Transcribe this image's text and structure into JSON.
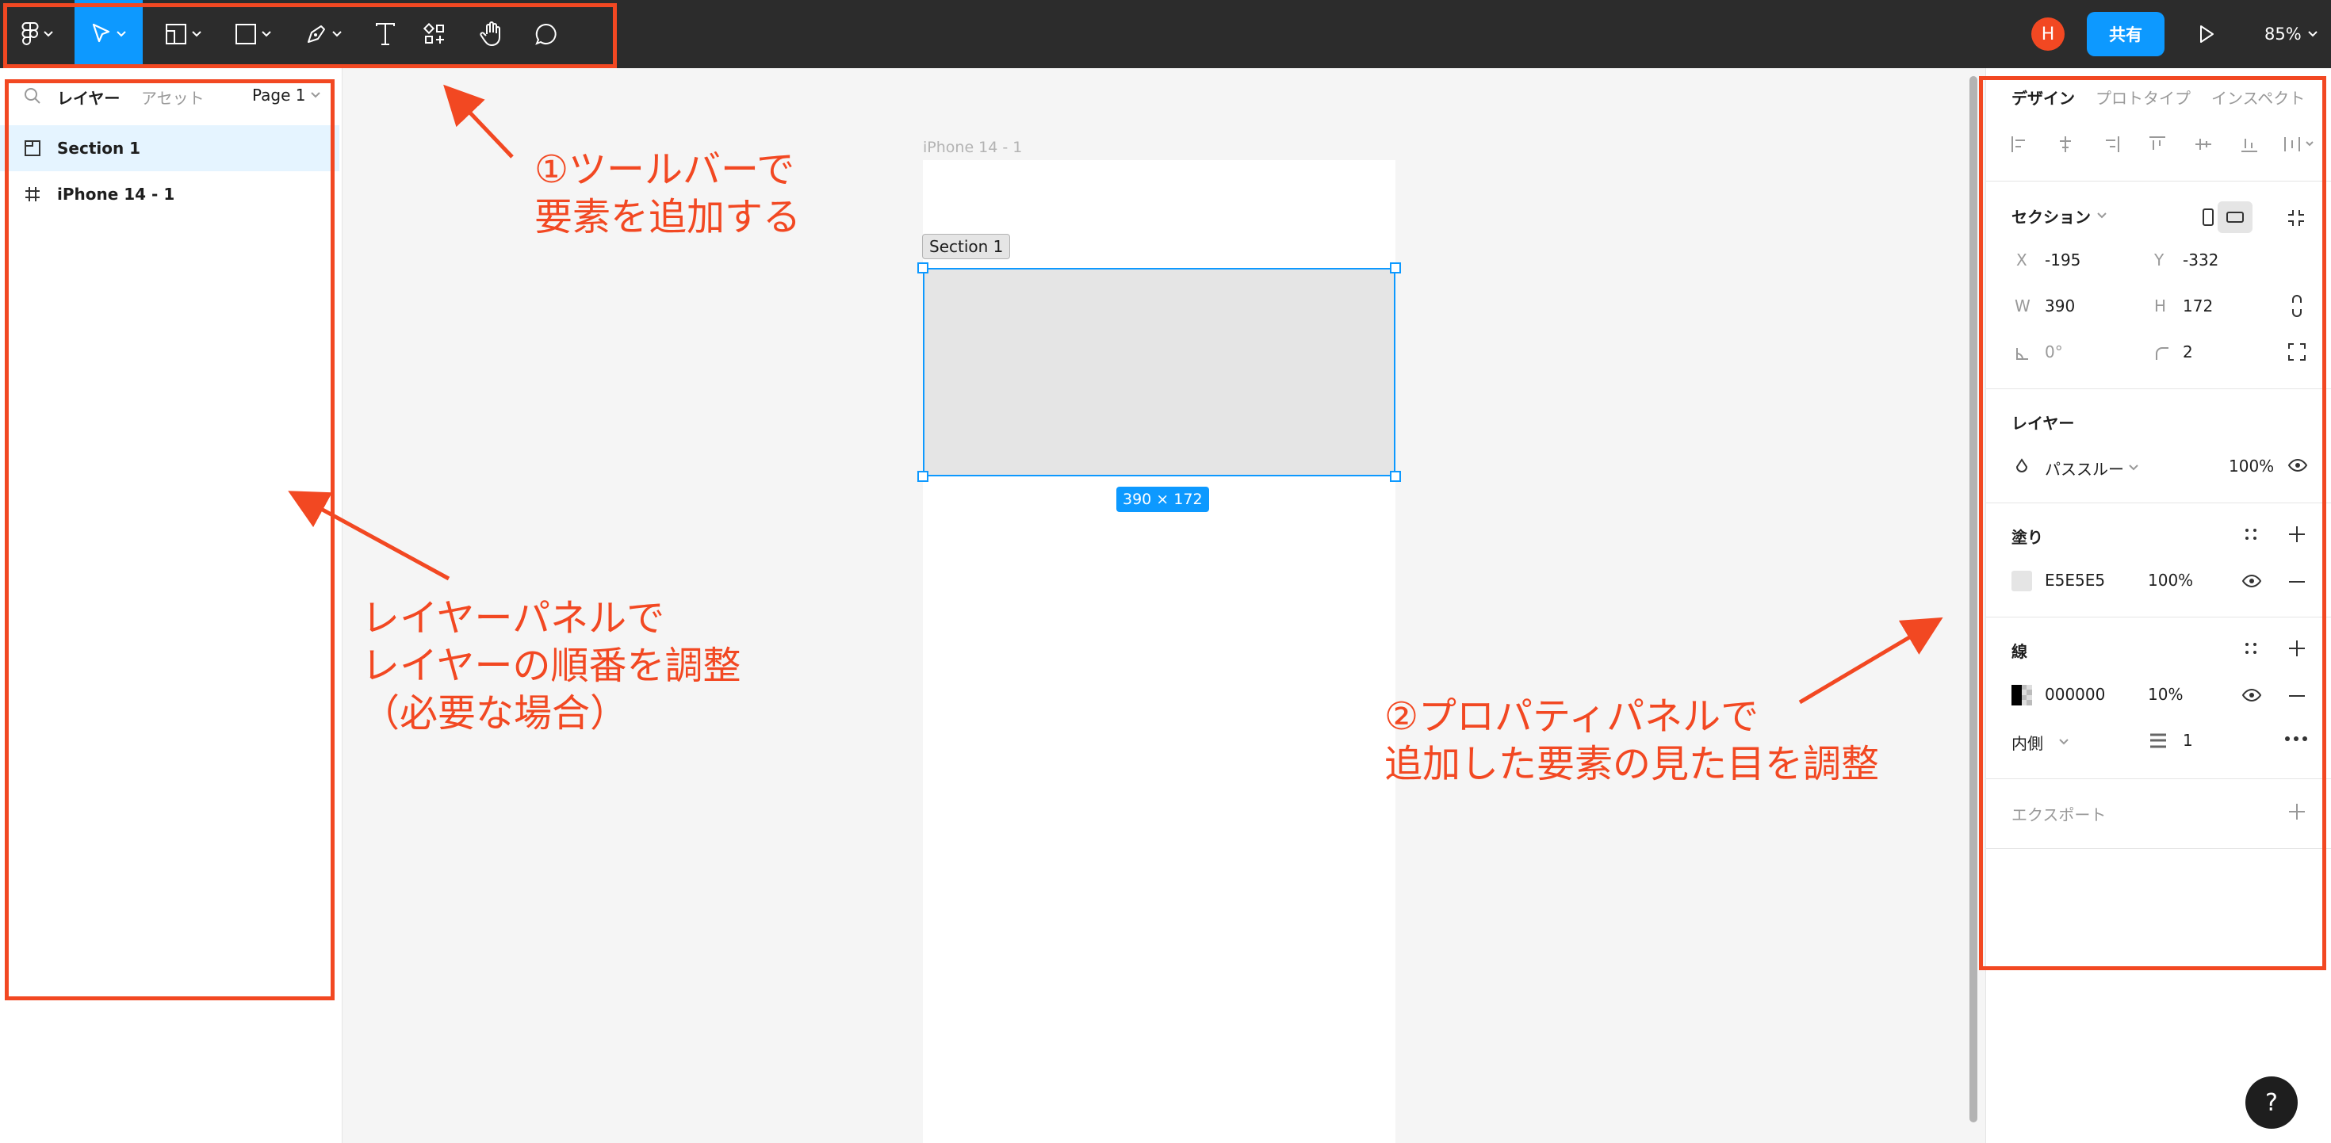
{
  "toolbar": {
    "tools": [
      {
        "name": "main-menu",
        "icon": "figma-logo-icon"
      },
      {
        "name": "move",
        "icon": "cursor-icon"
      },
      {
        "name": "frame",
        "icon": "frame-icon"
      },
      {
        "name": "shape",
        "icon": "rectangle-icon"
      },
      {
        "name": "pen",
        "icon": "pen-icon"
      },
      {
        "name": "text",
        "icon": "text-icon"
      },
      {
        "name": "resources",
        "icon": "components-icon"
      },
      {
        "name": "hand",
        "icon": "hand-icon"
      },
      {
        "name": "comment",
        "icon": "comment-icon"
      }
    ],
    "avatar_initial": "H",
    "share_label": "共有",
    "zoom": "85%"
  },
  "left_panel": {
    "tab_layers": "レイヤー",
    "tab_assets": "アセット",
    "page": "Page 1",
    "layers": [
      {
        "label": "Section 1",
        "icon": "section-icon",
        "selected": true
      },
      {
        "label": "iPhone 14 - 1",
        "icon": "frame-hash-icon",
        "selected": false
      }
    ]
  },
  "canvas": {
    "frame_label": "iPhone 14 - 1",
    "section_label": "Section 1",
    "size_tag": "390 × 172"
  },
  "right_panel": {
    "tabs": [
      "デザイン",
      "プロトタイプ",
      "インスペクト"
    ],
    "section_title": "セクション",
    "x_label": "X",
    "x": "-195",
    "y_label": "Y",
    "y": "-332",
    "w_label": "W",
    "w": "390",
    "h_label": "H",
    "h": "172",
    "rotation": "0°",
    "radius": "2",
    "layer_title": "レイヤー",
    "blend_mode": "パススルー",
    "layer_opacity": "100%",
    "fill_title": "塗り",
    "fill_hex": "E5E5E5",
    "fill_opacity": "100%",
    "stroke_title": "線",
    "stroke_hex": "000000",
    "stroke_opacity": "10%",
    "stroke_position": "内側",
    "stroke_weight": "1",
    "export_title": "エクスポート"
  },
  "annotations": {
    "toolbar_note": [
      "①ツールバーで",
      "要素を追加する"
    ],
    "layer_note": [
      "レイヤーパネルで",
      "レイヤーの順番を調整",
      "（必要な場合）"
    ],
    "property_note": [
      "②プロパティパネルで",
      "追加した要素の見た目を調整"
    ]
  },
  "help_label": "?",
  "colors": {
    "accent": "#0d99ff",
    "annotation": "#f24822",
    "toolbar_bg": "#2c2c2c",
    "fill": "#E5E5E5"
  }
}
